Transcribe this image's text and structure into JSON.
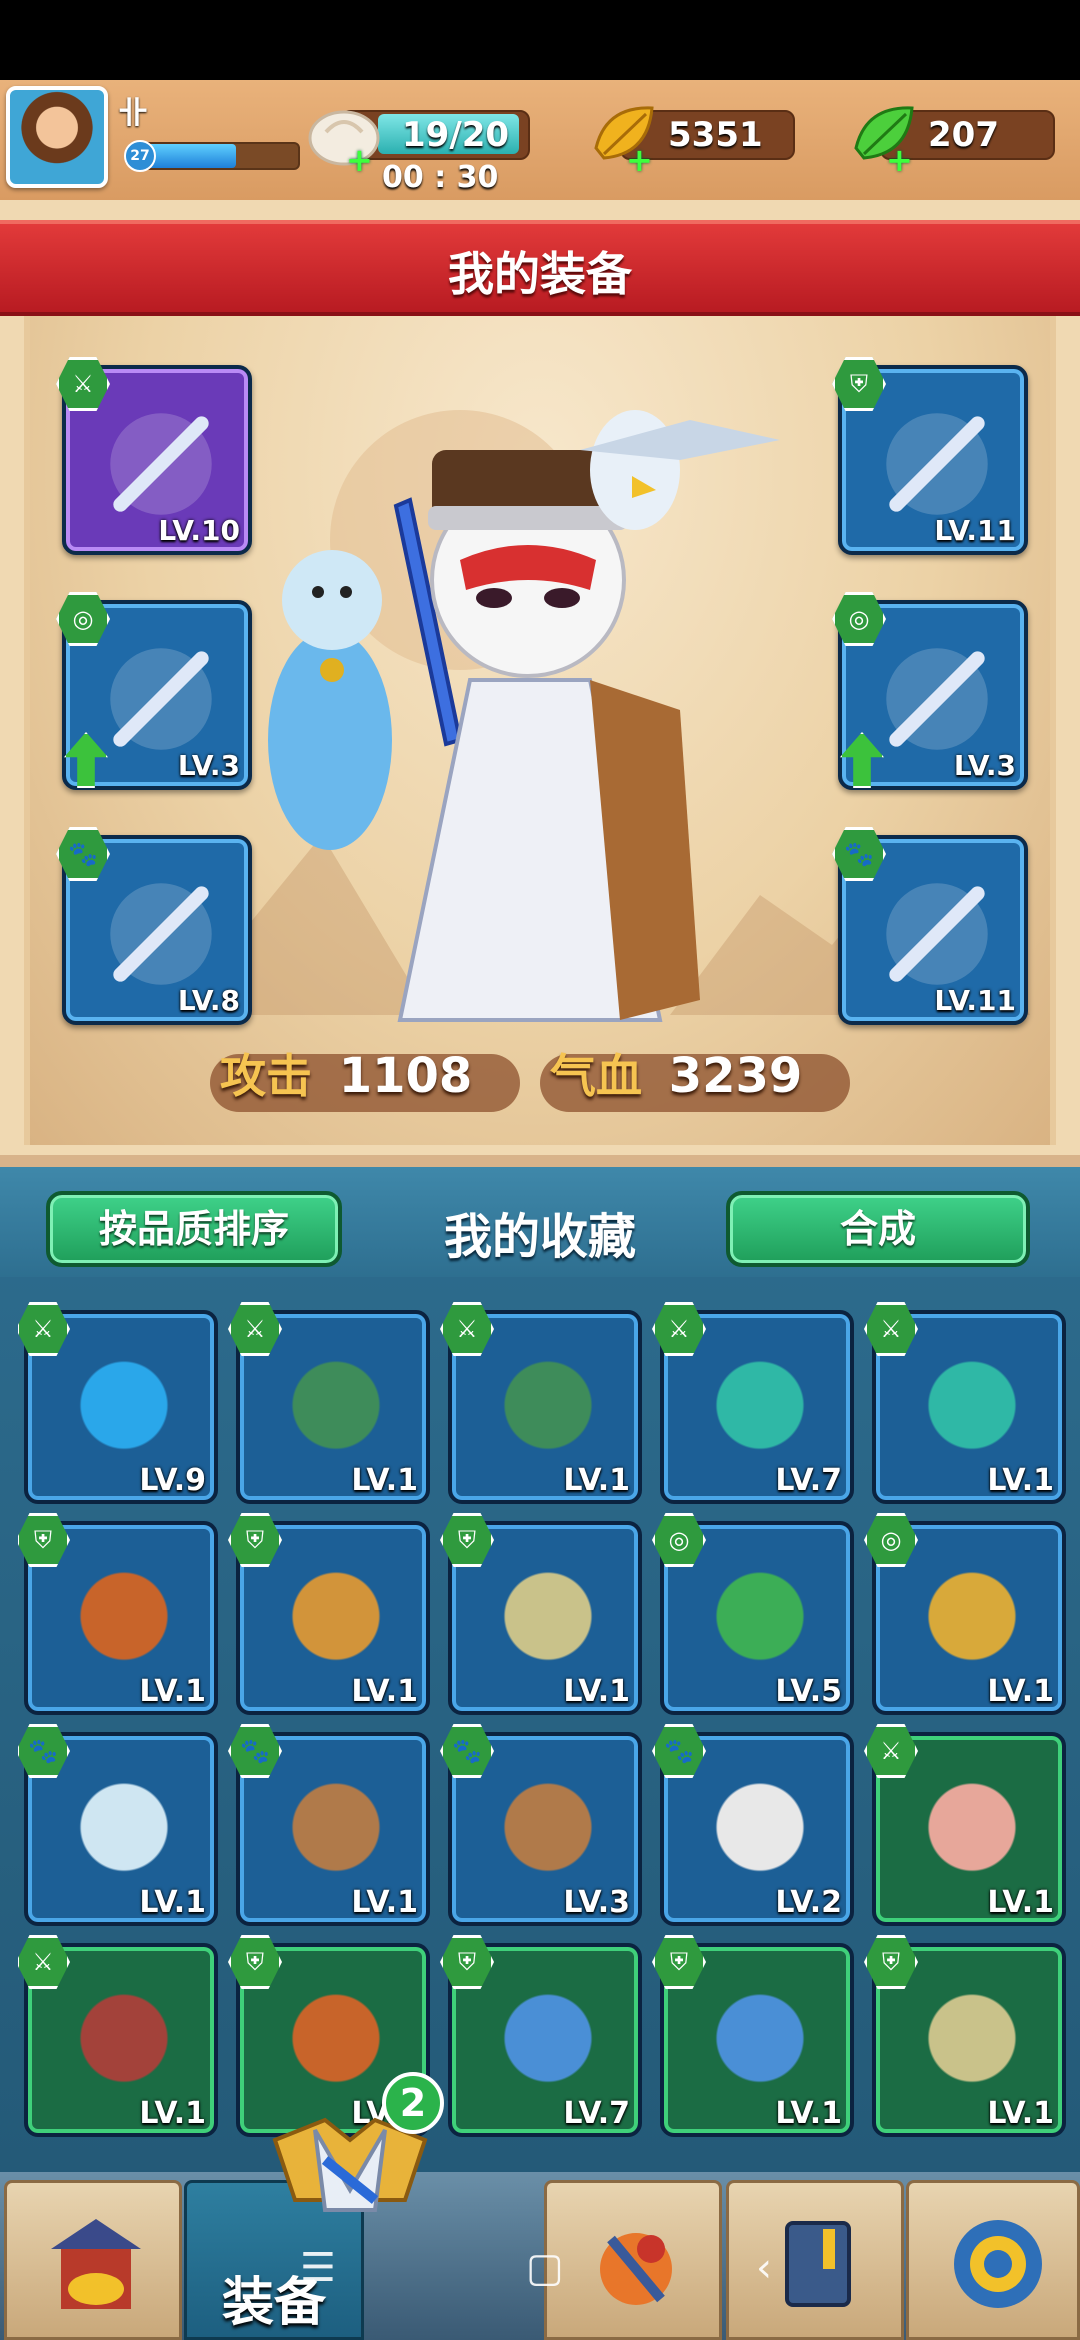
{
  "header": {
    "player_name": "卝",
    "player_level": "27",
    "xp_fraction": 0.6,
    "stamina": "19/20",
    "stamina_fraction": 0.95,
    "timer": "00 : 30",
    "gold": "5351",
    "jade": "207",
    "plus": "+"
  },
  "equipment": {
    "title": "我的装备",
    "slots": [
      {
        "level": "LV.10",
        "kind": "weapon",
        "badge": "⚔",
        "icon": "blue-sword-icon",
        "color": "purple"
      },
      {
        "level": "LV.11",
        "kind": "armor",
        "badge": "⛨",
        "icon": "armor-icon",
        "color": "blue"
      },
      {
        "level": "LV.3",
        "kind": "accessory",
        "badge": "◎",
        "icon": "jade-pendant-icon",
        "color": "blue",
        "upgrade": true
      },
      {
        "level": "LV.3",
        "kind": "accessory",
        "badge": "◎",
        "icon": "red-pendant-icon",
        "color": "blue",
        "upgrade": true
      },
      {
        "level": "LV.8",
        "kind": "pet",
        "badge": "🐾",
        "icon": "ferret-pet-icon",
        "color": "blue"
      },
      {
        "level": "LV.11",
        "kind": "pet",
        "badge": "🐾",
        "icon": "white-bird-pet-icon",
        "color": "blue"
      }
    ],
    "attack_label": "攻击",
    "attack_value": "1108",
    "hp_label": "气血",
    "hp_value": "3239"
  },
  "collection": {
    "sort_button": "按品质排序",
    "title": "我的收藏",
    "merge_button": "合成",
    "items": [
      {
        "level": "LV.9",
        "badge": "⚔",
        "icon": "blue-fan-icon",
        "color": "blue",
        "art": "#2aa7ea"
      },
      {
        "level": "LV.1",
        "badge": "⚔",
        "icon": "green-bow-icon",
        "color": "blue",
        "art": "#3e8c5a"
      },
      {
        "level": "LV.1",
        "badge": "⚔",
        "icon": "green-bow-icon",
        "color": "blue",
        "art": "#3e8c5a"
      },
      {
        "level": "LV.7",
        "badge": "⚔",
        "icon": "teal-dagger-icon",
        "color": "blue",
        "art": "#2fb8a6"
      },
      {
        "level": "LV.1",
        "badge": "⚔",
        "icon": "teal-dagger-icon",
        "color": "blue",
        "art": "#2fb8a6"
      },
      {
        "level": "LV.1",
        "badge": "⛨",
        "icon": "orange-robe-icon",
        "color": "blue",
        "art": "#c8642a"
      },
      {
        "level": "LV.1",
        "badge": "⛨",
        "icon": "armor-icon",
        "color": "blue",
        "art": "#d2943a"
      },
      {
        "level": "LV.1",
        "badge": "⛨",
        "icon": "green-robe-icon",
        "color": "blue",
        "art": "#c9c28a"
      },
      {
        "level": "LV.5",
        "badge": "◎",
        "icon": "green-pendant-icon",
        "color": "blue",
        "art": "#3cae56"
      },
      {
        "level": "LV.1",
        "badge": "◎",
        "icon": "gold-pendant-icon",
        "color": "blue",
        "art": "#d8a93a"
      },
      {
        "level": "LV.1",
        "badge": "🐾",
        "icon": "ferret-pet-icon",
        "color": "blue",
        "art": "#cfe6f2"
      },
      {
        "level": "LV.1",
        "badge": "🐾",
        "icon": "monkey-pet-icon",
        "color": "blue",
        "art": "#b07a4a"
      },
      {
        "level": "LV.3",
        "badge": "🐾",
        "icon": "monkey-pet-icon",
        "color": "blue",
        "art": "#b07a4a"
      },
      {
        "level": "LV.2",
        "badge": "🐾",
        "icon": "panda-pet-icon",
        "color": "blue",
        "art": "#e8e8e8"
      },
      {
        "level": "LV.1",
        "badge": "⚔",
        "icon": "pink-fan-icon",
        "color": "green",
        "art": "#e7a79a"
      },
      {
        "level": "LV.1",
        "badge": "⚔",
        "icon": "red-crossbow-icon",
        "color": "green",
        "art": "#a3423a"
      },
      {
        "level": "LV.1",
        "badge": "⛨",
        "icon": "orange-robe-icon",
        "color": "green",
        "art": "#c8642a"
      },
      {
        "level": "LV.7",
        "badge": "⛨",
        "icon": "blue-armor-icon",
        "color": "green",
        "art": "#4a8fd6"
      },
      {
        "level": "LV.1",
        "badge": "⛨",
        "icon": "blue-armor-icon",
        "color": "green",
        "art": "#4a8fd6"
      },
      {
        "level": "LV.1",
        "badge": "⛨",
        "icon": "green-robe-icon",
        "color": "green",
        "art": "#c9c28a"
      }
    ]
  },
  "bottom_nav": {
    "tabs": [
      {
        "icon": "shop-icon"
      },
      {
        "icon": "equipment-icon",
        "label": "装备",
        "active": true,
        "count": "2"
      },
      {
        "icon": "battle-icon"
      },
      {
        "icon": "book-icon"
      },
      {
        "icon": "settings-gear-icon"
      }
    ]
  }
}
